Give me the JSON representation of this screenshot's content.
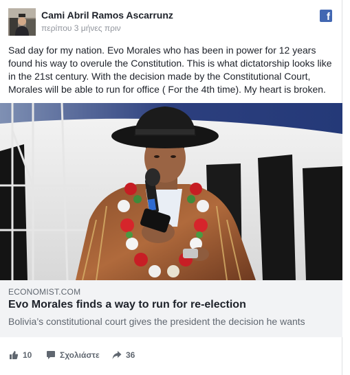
{
  "post": {
    "author": "Cami Abril Ramos Ascarrunz",
    "timestamp": "περίπου 3 μήνες πριν",
    "text": "Sad day for my nation. Evo Morales who has been in power for 12 years found his way to overule the Constitution. This is what dictatorship looks like in the 21st century. With the decision made by the Constitutional Court, Morales will be able to run for office ( For the 4th time). My heart is broken.",
    "brand_icon": "facebook-icon",
    "brand_icon_glyph": "f"
  },
  "link": {
    "domain": "ECONOMIST.COM",
    "title": "Evo Morales finds a way to run for re-election",
    "description": "Bolivia’s constitutional court gives the president the decision he wants"
  },
  "actions": {
    "likes": "10",
    "comment_label": "Σχολιάστε",
    "shares": "36"
  },
  "colors": {
    "facebook_blue": "#4267b2",
    "text_primary": "#1d2129",
    "text_secondary": "#606770",
    "timestamp_gray": "#90949c",
    "card_meta_bg": "#f2f3f5"
  }
}
